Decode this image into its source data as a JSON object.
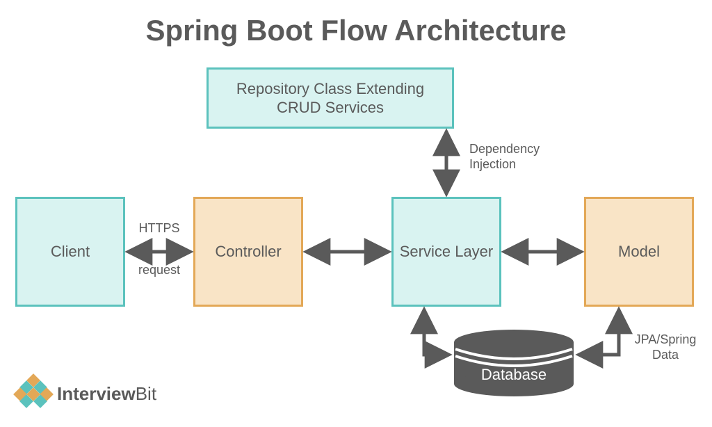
{
  "title": "Spring Boot Flow Architecture",
  "boxes": {
    "repository": "Repository Class Extending CRUD Services",
    "client": "Client",
    "controller": "Controller",
    "service": "Service Layer",
    "model": "Model"
  },
  "labels": {
    "https": "HTTPS",
    "request": "request",
    "dependency_injection": "Dependency Injection",
    "jpa": "JPA/Spring Data"
  },
  "database": "Database",
  "colors": {
    "cyan_fill": "#d9f3f1",
    "cyan_border": "#5bc2bd",
    "tan_fill": "#f9e4c6",
    "tan_border": "#e3a857",
    "arrow": "#5a5a5a",
    "text": "#5a5a5a"
  },
  "brand": {
    "name_bold": "Interview",
    "name_thin": "Bit"
  }
}
